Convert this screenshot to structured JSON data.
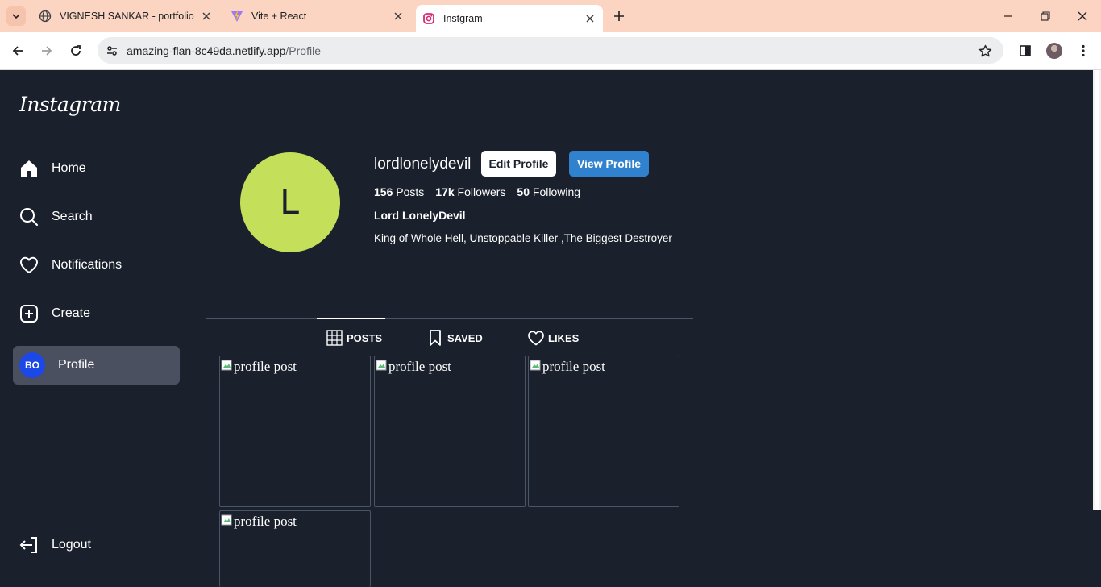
{
  "browser": {
    "tabs": [
      {
        "title": "VIGNESH SANKAR - portfolio",
        "icon": "globe-icon"
      },
      {
        "title": "Vite + React",
        "icon": "vite-icon"
      },
      {
        "title": "Instgram",
        "icon": "instagram-icon",
        "active": true
      }
    ],
    "url_host": "amazing-flan-8c49da.netlify.app",
    "url_path": "/Profile"
  },
  "sidebar": {
    "logo": "Instagram",
    "items": [
      {
        "label": "Home",
        "icon": "home-icon"
      },
      {
        "label": "Search",
        "icon": "search-icon"
      },
      {
        "label": "Notifications",
        "icon": "heart-icon"
      },
      {
        "label": "Create",
        "icon": "plus-square-icon"
      },
      {
        "label": "Profile",
        "icon": "avatar",
        "avatar_text": "BO",
        "active": true
      }
    ],
    "logout": "Logout"
  },
  "profile": {
    "avatar_letter": "L",
    "username": "lordlonelydevil",
    "edit_button": "Edit Profile",
    "view_button": "View Profile",
    "stats": {
      "posts_count": "156",
      "posts_label": "Posts",
      "followers_count": "17k",
      "followers_label": "Followers",
      "following_count": "50",
      "following_label": "Following"
    },
    "full_name": "Lord LonelyDevil",
    "bio": "King of Whole Hell, Unstoppable Killer ,The Biggest Destroyer"
  },
  "profile_tabs": [
    {
      "label": "POSTS",
      "icon": "grid-icon",
      "active": true
    },
    {
      "label": "SAVED",
      "icon": "bookmark-icon"
    },
    {
      "label": "LIKES",
      "icon": "heart-icon"
    }
  ],
  "posts": [
    {
      "alt": "profile post"
    },
    {
      "alt": "profile post"
    },
    {
      "alt": "profile post"
    },
    {
      "alt": "profile post"
    }
  ],
  "colors": {
    "background": "#1a202c",
    "avatar": "#c4df5a",
    "view_button": "#3182ce",
    "profile_avatar_badge": "#1c48e8",
    "tabbar": "#fbd5c2"
  }
}
